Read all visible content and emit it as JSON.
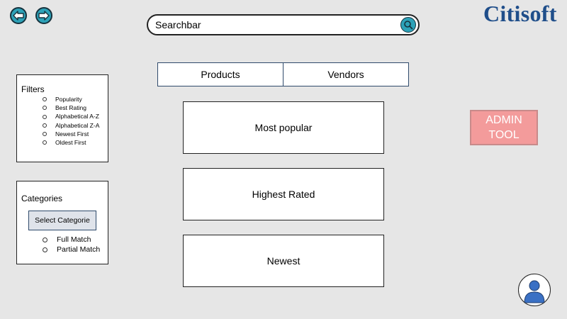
{
  "nav": {
    "back_icon": "arrow-left-icon",
    "forward_icon": "arrow-right-icon"
  },
  "search": {
    "text": "Searchbar",
    "icon": "search-icon"
  },
  "brand": {
    "logo": "Citisoft",
    "color": "#1f4e8a"
  },
  "tabs": [
    {
      "label": "Products"
    },
    {
      "label": "Vendors"
    }
  ],
  "filters": {
    "title": "Filters",
    "options": [
      "Popularity",
      "Best Rating",
      "Alphabetical A-Z",
      "Alphabetical Z-A",
      "Newest First",
      "Oldest First"
    ]
  },
  "categories": {
    "title": "Categories",
    "select_label": "Select Categorie",
    "options": [
      "Full Match",
      "Partial Match"
    ]
  },
  "cards": [
    "Most popular",
    "Highest Rated",
    "Newest"
  ],
  "admin": {
    "label_line1": "ADMIN",
    "label_line2": "TOOL",
    "color": "#f39b9b"
  },
  "user": {
    "icon": "user-icon"
  },
  "colors": {
    "accent": "#2da2b8",
    "background": "#e6e6e6"
  }
}
